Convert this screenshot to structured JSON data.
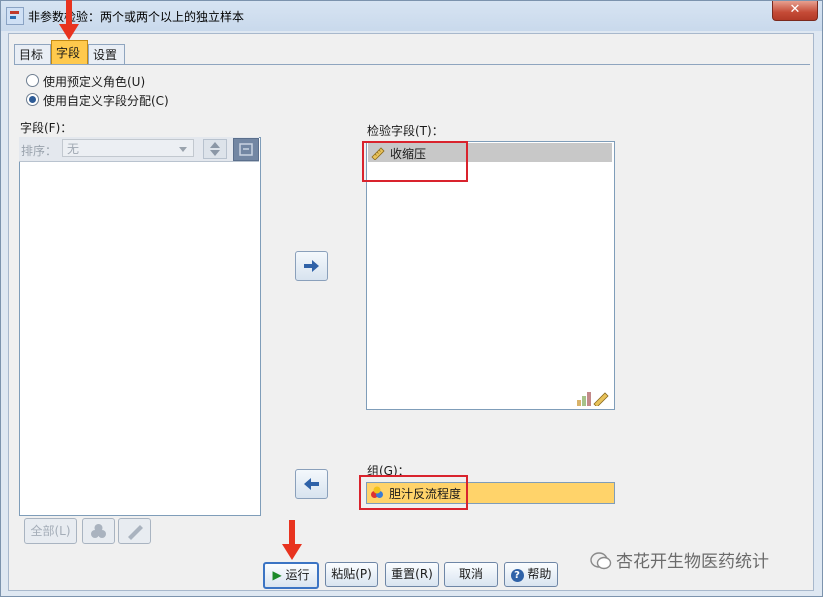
{
  "window": {
    "title": "非参数检验：两个或两个以上的独立样本",
    "close_label": "✕"
  },
  "tabs": [
    {
      "label": "目标"
    },
    {
      "label": "字段"
    },
    {
      "label": "设置"
    }
  ],
  "options": {
    "predefined_roles": "使用预定义角色(U)",
    "custom_assignments": "使用自定义字段分配(C)",
    "selected": "custom_assignments"
  },
  "fields": {
    "label": "字段(F)：",
    "sort_label": "排序：",
    "sort_value": "无",
    "select_all_label": "全部(L)"
  },
  "test_fields": {
    "label": "检验字段(T)：",
    "items": [
      {
        "name": "收缩压",
        "icon": "scale-ruler-icon"
      }
    ]
  },
  "groups": {
    "label": "组(G)：",
    "value": "胆汁反流程度",
    "icon": "nominal-three-circles-icon"
  },
  "buttons": {
    "run": "运行",
    "paste": "粘贴(P)",
    "reset": "重置(R)",
    "cancel": "取消",
    "help": "帮助"
  },
  "watermark": "杏花开生物医药统计",
  "colors": {
    "active_tab": "#ffc94d",
    "group_field": "#ffd36a",
    "highlight": "#d9232d",
    "annotation_arrow": "#e8331f"
  }
}
